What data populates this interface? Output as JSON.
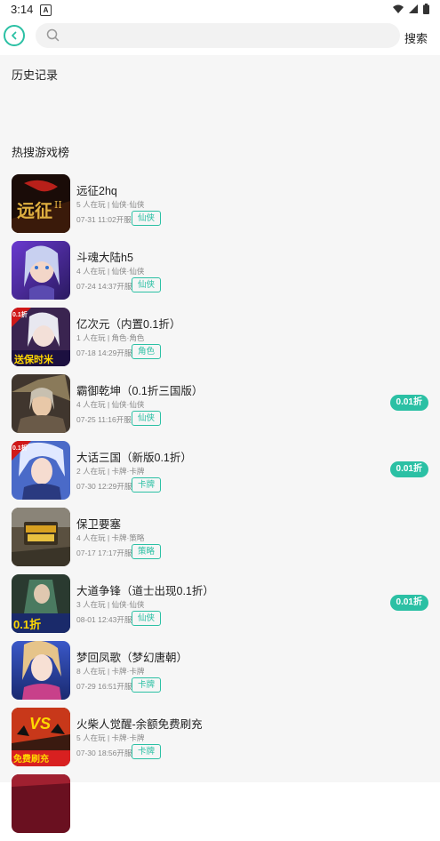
{
  "status": {
    "time": "3:14",
    "notice_glyph": "A"
  },
  "search": {
    "placeholder": "",
    "button_label": "搜索"
  },
  "sections": {
    "history_title": "历史记录",
    "hot_title": "热搜游戏榜"
  },
  "colors": {
    "accent": "#2bc0a4",
    "background": "#f6f6f6"
  },
  "games": [
    {
      "name": "远征2hq",
      "players": "5 人在玩",
      "genre": "仙侠·仙侠",
      "date": "07-31 11:02开服",
      "tag": "仙侠",
      "discount": "",
      "icon": "game-icon-yuanzheng"
    },
    {
      "name": "斗魂大陆h5",
      "players": "4 人在玩",
      "genre": "仙侠·仙侠",
      "date": "07-24 14:37开服",
      "tag": "仙侠",
      "discount": "",
      "icon": "game-icon-douhun"
    },
    {
      "name": "亿次元（内置0.1折）",
      "players": "1 人在玩",
      "genre": "角色·角色",
      "date": "07-18 14:29开服",
      "tag": "角色",
      "discount": "",
      "icon": "game-icon-yiciyuan"
    },
    {
      "name": "霸御乾坤（0.1折三国版）",
      "players": "4 人在玩",
      "genre": "仙侠·仙侠",
      "date": "07-25 11:16开服",
      "tag": "仙侠",
      "discount": "0.01折",
      "icon": "game-icon-bayu"
    },
    {
      "name": "大话三国（新版0.1折）",
      "players": "2 人在玩",
      "genre": "卡牌·卡牌",
      "date": "07-30 12:29开服",
      "tag": "卡牌",
      "discount": "0.01折",
      "icon": "game-icon-dahua"
    },
    {
      "name": "保卫要塞",
      "players": "4 人在玩",
      "genre": "卡牌·策略",
      "date": "07-17 17:17开服",
      "tag": "策略",
      "discount": "",
      "icon": "game-icon-baowei"
    },
    {
      "name": "大道争锋（道士出现0.1折）",
      "players": "3 人在玩",
      "genre": "仙侠·仙侠",
      "date": "08-01 12:43开服",
      "tag": "仙侠",
      "discount": "0.01折",
      "icon": "game-icon-dadao"
    },
    {
      "name": "梦回凤歌（梦幻唐朝）",
      "players": "8 人在玩",
      "genre": "卡牌·卡牌",
      "date": "07-29 16:51开服",
      "tag": "卡牌",
      "discount": "",
      "icon": "game-icon-menghui"
    },
    {
      "name": "火柴人觉醒-余额免费刷充",
      "players": "5 人在玩",
      "genre": "卡牌·卡牌",
      "date": "07-30 18:56开服",
      "tag": "卡牌",
      "discount": "",
      "icon": "game-icon-huochai"
    }
  ]
}
